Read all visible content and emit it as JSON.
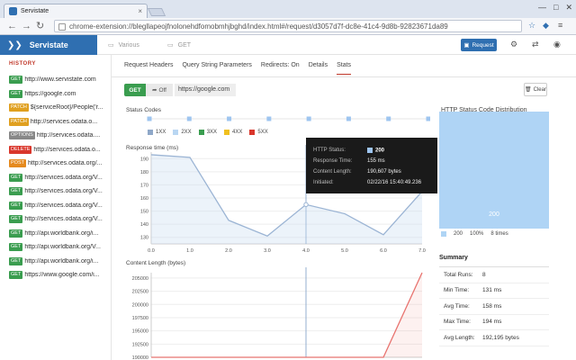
{
  "browser": {
    "tab_title": "Servistate",
    "tab_close": "×",
    "url": "chrome-extension://blegllapeojfnolonehdfomobmhjbghd/index.html#/request/d3057d7f-dc8e-41c4-9d8b-92823671da89",
    "controls": [
      "—",
      "□",
      "✕"
    ]
  },
  "app": {
    "name": "Servistate",
    "brand_color": "#2f6fb1",
    "crumb_prev": "Various",
    "crumb_current": "GET",
    "request_label": "Request"
  },
  "sidebar": {
    "title": "HISTORY",
    "items": [
      {
        "method": "GET",
        "url": "http://www.servistate.com",
        "color": "#3a9d4f"
      },
      {
        "method": "GET",
        "url": "https://google.com",
        "color": "#3a9d4f"
      },
      {
        "method": "PATCH",
        "url": "${serviceRoot}/People('r...",
        "color": "#e0a020"
      },
      {
        "method": "PATCH",
        "url": "http://services.odata.o...",
        "color": "#e0a020"
      },
      {
        "method": "OPTIONS",
        "url": "http://services.odata....",
        "color": "#888888"
      },
      {
        "method": "DELETE",
        "url": "http://services.odata.o...",
        "color": "#d9362b"
      },
      {
        "method": "POST",
        "url": "http://services.odata.org/...",
        "color": "#e58a1f"
      },
      {
        "method": "GET",
        "url": "http://services.odata.org/V...",
        "color": "#3a9d4f"
      },
      {
        "method": "GET",
        "url": "http://services.odata.org/V...",
        "color": "#3a9d4f"
      },
      {
        "method": "GET",
        "url": "http://services.odata.org/V...",
        "color": "#3a9d4f"
      },
      {
        "method": "GET",
        "url": "http://services.odata.org/V...",
        "color": "#3a9d4f"
      },
      {
        "method": "GET",
        "url": "http://api.worldbank.org/i...",
        "color": "#3a9d4f"
      },
      {
        "method": "GET",
        "url": "http://api.worldbank.org/V...",
        "color": "#3a9d4f"
      },
      {
        "method": "GET",
        "url": "http://api.worldbank.org/i...",
        "color": "#3a9d4f"
      },
      {
        "method": "GET",
        "url": "https://www.google.com/i...",
        "color": "#3a9d4f"
      }
    ]
  },
  "main": {
    "tabs": [
      {
        "label": "Request Headers",
        "active": false
      },
      {
        "label": "Query String Parameters",
        "active": false
      },
      {
        "label": "Redirects: On",
        "active": false
      },
      {
        "label": "Details",
        "active": false
      },
      {
        "label": "Stats",
        "active": true
      }
    ],
    "method": "GET",
    "off_label": "Off",
    "request_url": "https://google.com",
    "clear_label": "Clear",
    "status_codes_title": "Status Codes",
    "status_legend": [
      {
        "label": "1XX",
        "color": "#8fa8c8"
      },
      {
        "label": "2XX",
        "color": "#b9d6f2"
      },
      {
        "label": "3XX",
        "color": "#3a9d4f"
      },
      {
        "label": "4XX",
        "color": "#f0c020"
      },
      {
        "label": "5XX",
        "color": "#d9362b"
      }
    ],
    "response_time_title": "Response time (ms)",
    "content_length_title": "Content Length (bytes)",
    "dist_title": "HTTP Status Code Distribution",
    "dist_bar_label": "200",
    "dist_legend": {
      "code": "200",
      "percent": "100%",
      "times": "8 times"
    },
    "summary_title": "Summary",
    "summary": [
      {
        "k": "Total Runs:",
        "v": "8"
      },
      {
        "k": "Min Time:",
        "v": "131 ms"
      },
      {
        "k": "Avg Time:",
        "v": "158 ms"
      },
      {
        "k": "Max Time:",
        "v": "194 ms"
      },
      {
        "k": "Avg Length:",
        "v": "192,195 bytes"
      }
    ]
  },
  "tooltip": {
    "status_k": "HTTP Status:",
    "status_v": "200",
    "time_k": "Response Time:",
    "time_v": "155 ms",
    "len_k": "Content Length:",
    "len_v": "190,607 bytes",
    "init_k": "Initiated:",
    "init_v": "02/22/16 15:40:49.236"
  },
  "chart_data": [
    {
      "type": "line",
      "title": "Response time (ms)",
      "x": [
        0,
        1,
        2,
        3,
        4,
        5,
        6,
        7
      ],
      "values": [
        193,
        191,
        143,
        131,
        155,
        148,
        132,
        165
      ],
      "xticks": [
        "0.0",
        "1.0",
        "2.0",
        "3.0",
        "4.0",
        "5.0",
        "6.0",
        "7.0"
      ],
      "yticks": [
        "130",
        "140",
        "150",
        "160",
        "170",
        "180",
        "190"
      ],
      "xlim": [
        0,
        7
      ],
      "ylim": [
        125,
        195
      ],
      "color": "#9bb4d4"
    },
    {
      "type": "line",
      "title": "Content Length (bytes)",
      "x": [
        0,
        1,
        2,
        3,
        4,
        5,
        6,
        7
      ],
      "values": [
        190000,
        190000,
        190000,
        190000,
        190000,
        190000,
        190000,
        206000
      ],
      "yticks": [
        "190000",
        "192500",
        "195000",
        "197500",
        "200000",
        "202500",
        "205000"
      ],
      "xlim": [
        0,
        7
      ],
      "ylim": [
        190000,
        206000
      ],
      "color": "#e8736f"
    }
  ]
}
